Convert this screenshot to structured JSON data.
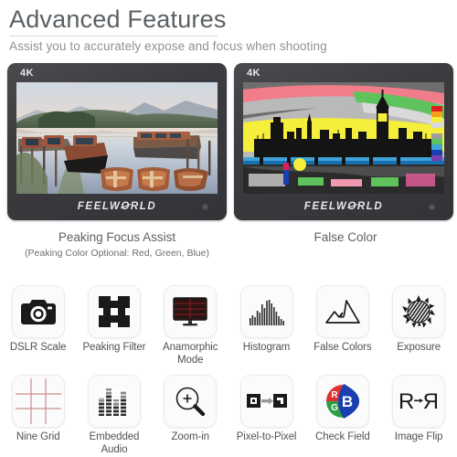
{
  "header": {
    "title": "Advanced Features",
    "subtitle": "Assist you to accurately expose and focus when shooting"
  },
  "monitors": [
    {
      "id": "peaking-focus-assist",
      "badge": "4K",
      "brand_prefix": "FEELW",
      "brand_o": "O",
      "brand_suffix": "RLD",
      "screen_content": "lake scene with moored wooden boats, misty hills and sunrise reflection",
      "caption": "Peaking Focus Assist",
      "caption_sub": "(Peaking Color Optional: Red, Green, Blue)"
    },
    {
      "id": "false-color",
      "badge": "4K",
      "brand_prefix": "FEELW",
      "brand_o": "O",
      "brand_suffix": "RLD",
      "screen_content": "false-color exposure map of Houses of Parliament and Big Ben with colour scale bar",
      "caption": "False Color",
      "caption_sub": ""
    }
  ],
  "features": [
    {
      "icon": "dslr-camera-icon",
      "label": "DSLR Scale"
    },
    {
      "icon": "peaking-filter-icon",
      "label": "Peaking Filter"
    },
    {
      "icon": "anamorphic-monitor-icon",
      "label": "Anamorphic Mode"
    },
    {
      "icon": "histogram-icon",
      "label": "Histogram"
    },
    {
      "icon": "false-colors-mountain-icon",
      "label": "False Colors"
    },
    {
      "icon": "exposure-sun-icon",
      "label": "Exposure"
    },
    {
      "icon": "nine-grid-icon",
      "label": "Nine Grid"
    },
    {
      "icon": "embedded-audio-icon",
      "label": "Embedded Audio"
    },
    {
      "icon": "zoom-in-magnifier-icon",
      "label": "Zoom-in"
    },
    {
      "icon": "pixel-to-pixel-icon",
      "label": "Pixel-to-Pixel"
    },
    {
      "icon": "check-field-rgb-icon",
      "label": "Check Field"
    },
    {
      "icon": "image-flip-icon",
      "label": "Image Flip"
    }
  ],
  "check_field": {
    "r": "R",
    "g": "G",
    "b": "B"
  },
  "image_flip": {
    "glyph": "R"
  },
  "colors": {
    "title": "#5b6064",
    "subtitle": "#8d9295",
    "label": "#4e5256",
    "bezel": "#3c3c40",
    "tile_bg": "#fbfbfb",
    "check_red": "#e03131",
    "check_green": "#2f9e44",
    "check_blue": "#1a3fae",
    "anamorphic_red": "#8c1c1c",
    "nine_grid_line": "#c98e8e"
  }
}
